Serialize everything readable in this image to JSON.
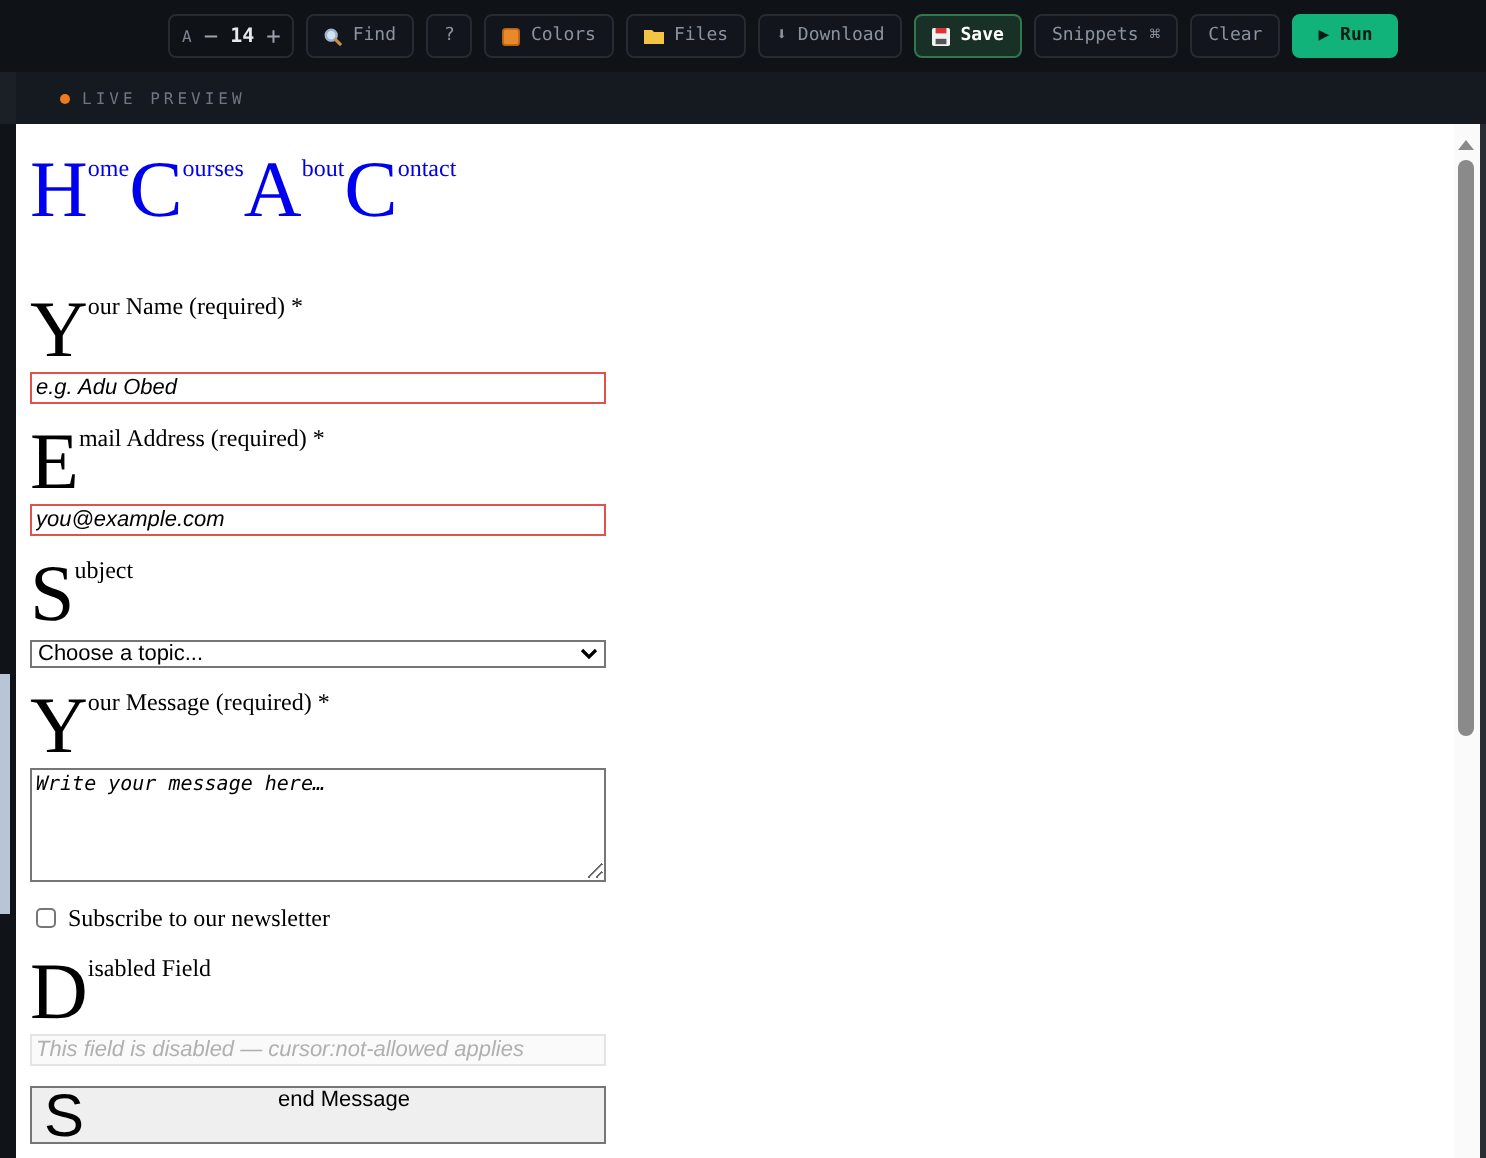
{
  "toolbar": {
    "font_size": {
      "letter": "A",
      "minus": "−",
      "value": "14",
      "plus": "+"
    },
    "buttons": [
      {
        "kind": "find",
        "label": "Find"
      },
      {
        "kind": "plain",
        "label": "?"
      },
      {
        "kind": "colors",
        "label": "Colors"
      },
      {
        "kind": "files",
        "label": "Files"
      },
      {
        "kind": "plain",
        "label": "⬇ Download"
      },
      {
        "kind": "save",
        "label": "Save"
      },
      {
        "kind": "plain",
        "label": "Snippets ⌘"
      },
      {
        "kind": "plain",
        "label": "Clear"
      },
      {
        "kind": "run",
        "label": "▶ Run"
      }
    ]
  },
  "preview": {
    "title": "LIVE PREVIEW",
    "nav": [
      "Home",
      "Courses",
      "About",
      "Contact"
    ],
    "fields": [
      {
        "kind": "text",
        "label": "Your Name (required) *",
        "placeholder": "e.g. Adu Obed",
        "invalid": true
      },
      {
        "kind": "text",
        "label": "Email Address (required) *",
        "placeholder": "you@example.com",
        "invalid": true
      },
      {
        "kind": "select",
        "label": "Subject",
        "value": "Choose a topic..."
      },
      {
        "kind": "textarea",
        "label": "Your Message (required) *",
        "placeholder": "Write your message here…"
      },
      {
        "kind": "checkbox",
        "label": "Subscribe to our newsletter",
        "checked": false
      },
      {
        "kind": "text",
        "label": "Disabled Field",
        "placeholder": "This field is disabled — cursor:not-allowed applies",
        "disabled": true
      },
      {
        "kind": "button",
        "label": "Send Message"
      }
    ]
  }
}
